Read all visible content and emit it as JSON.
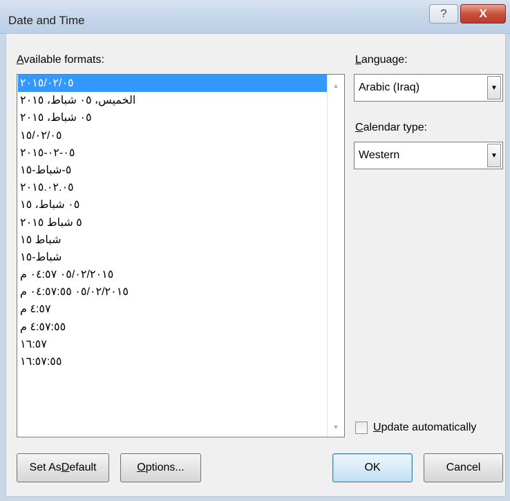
{
  "window": {
    "title": "Date and Time",
    "help_label": "?",
    "close_label": "X"
  },
  "formats": {
    "label_prefix": "A",
    "label_rest": "vailable formats:",
    "items": [
      "٢٠١٥/٠٢/٠٥",
      "الخميس، ٠٥ شباط، ٢٠١٥",
      "٠٥ شباط، ٢٠١٥",
      "١٥/٠٢/٠٥",
      "٠٥-٠٢-٢٠١٥",
      "٥-شباط-١٥",
      "٢٠١٥.٠٢.٠٥",
      "٠٥ شباط، ١٥",
      "٥ شباط ٢٠١٥",
      "شباط ١٥",
      "شباط-١٥",
      "٠٥/٠٢/٢٠١٥ ٠٤:٥٧ م",
      "٠٥/٠٢/٢٠١٥ ٠٤:٥٧:٥٥ م",
      "٤:٥٧ م",
      "٤:٥٧:٥٥ م",
      "١٦:٥٧",
      "١٦:٥٧:٥٥"
    ],
    "selected_index": 0
  },
  "language": {
    "label_prefix": "L",
    "label_rest": "anguage:",
    "value": "Arabic (Iraq)"
  },
  "calendar": {
    "label_prefix": "C",
    "label_rest": "alendar type:",
    "value": "Western"
  },
  "update": {
    "label_prefix": "U",
    "label_rest": "pdate automatically",
    "checked": false
  },
  "buttons": {
    "set_default_pre": "Set As ",
    "set_default_key": "D",
    "set_default_post": "efault",
    "options_key": "O",
    "options_rest": "ptions...",
    "ok": "OK",
    "cancel": "Cancel"
  },
  "colors": {
    "selection": "#3399ff",
    "dialog_bg": "#f0f0f0",
    "close_red": "#c9523d"
  }
}
